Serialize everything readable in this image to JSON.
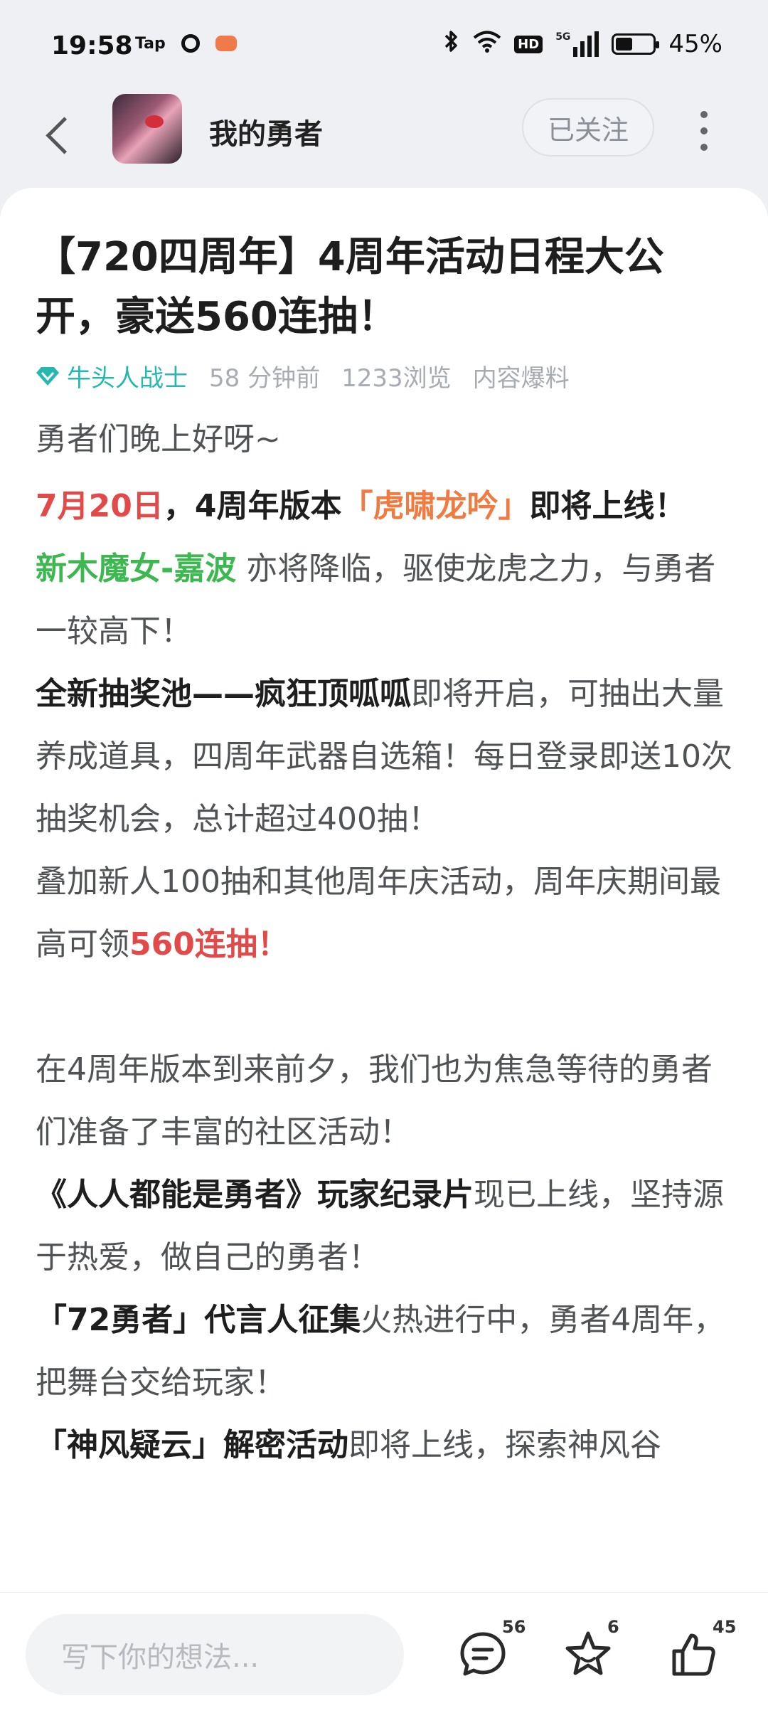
{
  "status_bar": {
    "time": "19:58",
    "tap": "Tap",
    "hd": "HD",
    "network": "5G",
    "battery": "45%",
    "battery_level": 0.45
  },
  "header": {
    "channel_name": "我的勇者",
    "follow_label": "已关注"
  },
  "post": {
    "title": "【720四周年】4周年活动日程大公开，豪送560连抽！",
    "author": "牛头人战士",
    "time_ago": "58 分钟前",
    "views": "1233浏览",
    "category": "内容爆料",
    "body": {
      "greeting": "勇者们晚上好呀~",
      "p1_date": "7月20日",
      "p1_mid": "，4周年版本",
      "p1_name": "「虎啸龙吟」",
      "p1_end": "即将上线！",
      "p2_hero": "新木魔女-嘉波",
      "p2_rest": " 亦将降临，驱使龙虎之力，与勇者一较高下！",
      "p3_bold": "全新抽奖池——疯狂顶呱呱",
      "p3_rest": "即将开启，可抽出大量养成道具，四周年武器自选箱！每日登录即送10次抽奖机会，总计超过400抽！",
      "p4_rest": "叠加新人100抽和其他周年庆活动，周年庆期间最高可领",
      "p4_red": "560连抽！",
      "p5": "在4周年版本到来前夕，我们也为焦急等待的勇者们准备了丰富的社区活动！",
      "p6_bold": "《人人都能是勇者》玩家纪录片",
      "p6_rest": "现已上线，坚持源于热爱，做自己的勇者！",
      "p7_bold": "「72勇者」代言人征集",
      "p7_rest": "火热进行中，勇者4周年，把舞台交给玩家！",
      "p8_bold": "「神风疑云」解密活动",
      "p8_rest": "即将上线，探索神风谷"
    }
  },
  "bottom_bar": {
    "comment_placeholder": "写下你的想法...",
    "comments_count": "56",
    "favorites_count": "6",
    "likes_count": "45"
  },
  "colors": {
    "author": "#25b7b0",
    "red": "#e24a4a",
    "orange": "#f07a3f",
    "green": "#3db850"
  }
}
